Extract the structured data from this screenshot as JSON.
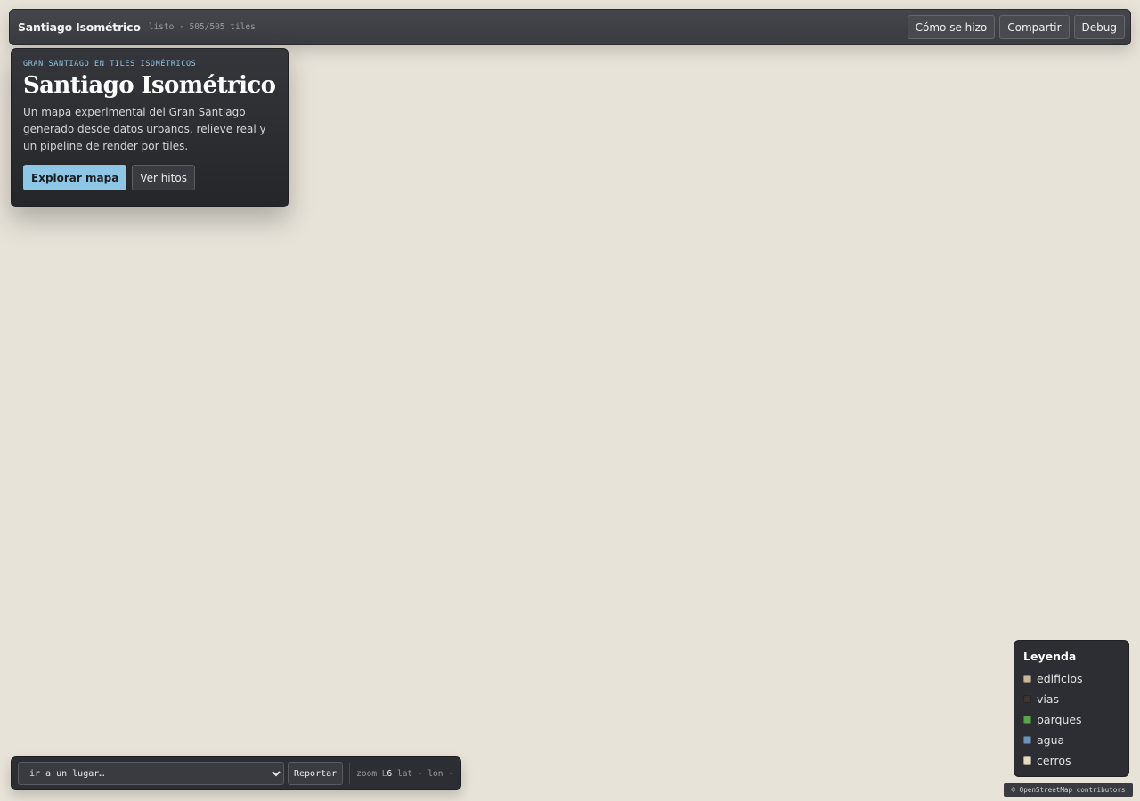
{
  "topbar": {
    "title": "Santiago Isométrico",
    "status": "listo · 505/505 tiles",
    "buttons": [
      "Cómo se hizo",
      "Compartir",
      "Debug"
    ]
  },
  "intro": {
    "kicker": "GRAN SANTIAGO EN TILES ISOMÉTRICOS",
    "title": "Santiago Isométrico",
    "description": "Un mapa experimental del Gran Santiago generado desde datos urbanos, relieve real y un pipeline de render por tiles.",
    "primary_label": "Explorar mapa",
    "secondary_label": "Ver hitos"
  },
  "bottombar": {
    "place_select_value": "ir a un lugar…",
    "report_label": "Reportar",
    "zoom_prefix": "zoom L",
    "zoom_value": "6",
    "lat_label": "lat ·",
    "lon_label": "lon ·"
  },
  "legend": {
    "title": "Leyenda",
    "items": [
      {
        "label": "edificios",
        "color": "#c7b89c"
      },
      {
        "label": "vías",
        "color": "#3a3632"
      },
      {
        "label": "parques",
        "color": "#5aa54a"
      },
      {
        "label": "agua",
        "color": "#6e93b8"
      },
      {
        "label": "cerros",
        "color": "#e6dcc2"
      }
    ]
  },
  "attribution": "© OpenStreetMap contributors",
  "colors": {
    "map_background": "#e7e3d9",
    "accent": "#8ec7e6",
    "panel": "#2d2e33"
  }
}
